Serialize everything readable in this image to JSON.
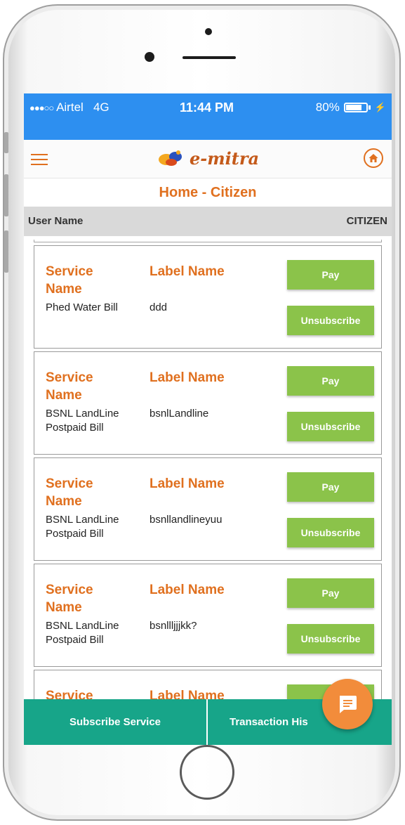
{
  "status_bar": {
    "signal_dots": "●●●○○",
    "carrier": "Airtel",
    "network": "4G",
    "time": "11:44 PM",
    "battery_percent": "80%",
    "battery_level": 0.8,
    "background_color": "#2d8ff0"
  },
  "header": {
    "logo_text": "e-mitra",
    "menu_icon": "hamburger-icon",
    "home_icon": "home-icon"
  },
  "page": {
    "title": "Home - Citizen"
  },
  "user_info": {
    "label": "User Name",
    "value": "CITIZEN"
  },
  "cards": [
    {
      "service_header": "Service Name",
      "label_header": "Label Name",
      "service_value": "Phed Water Bill",
      "label_value": "ddd",
      "pay_label": "Pay",
      "unsubscribe_label": "Unsubscribe"
    },
    {
      "service_header": "Service Name",
      "label_header": "Label Name",
      "service_value": "BSNL LandLine Postpaid Bill",
      "label_value": "bsnlLandline",
      "pay_label": "Pay",
      "unsubscribe_label": "Unsubscribe"
    },
    {
      "service_header": "Service Name",
      "label_header": "Label Name",
      "service_value": "BSNL LandLine Postpaid Bill",
      "label_value": "bsnllandlineyuu",
      "pay_label": "Pay",
      "unsubscribe_label": "Unsubscribe"
    },
    {
      "service_header": "Service Name",
      "label_header": "Label Name",
      "service_value": "BSNL LandLine Postpaid Bill",
      "label_value": "bsnllljjjkk?",
      "pay_label": "Pay",
      "unsubscribe_label": "Unsubscribe"
    },
    {
      "service_header": "Service",
      "label_header": "Label Name"
    }
  ],
  "bottom_nav": {
    "subscribe_label": "Subscribe Service",
    "history_label": "Transaction His"
  },
  "fab": {
    "icon": "chat-icon"
  },
  "colors": {
    "accent": "#e0701f",
    "button_green": "#8bc34a",
    "bottom_bar": "#17a589",
    "fab": "#f28c3b"
  }
}
